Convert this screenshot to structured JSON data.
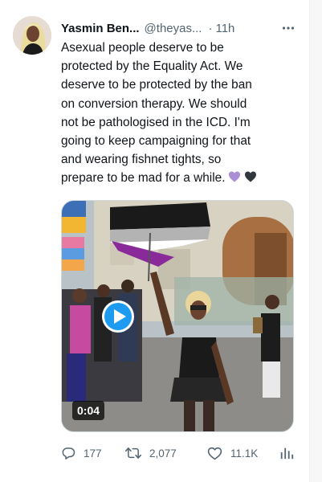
{
  "tweet": {
    "author": {
      "display_name": "Yasmin Ben...",
      "handle": "@theyas...",
      "separator": "·",
      "time": "11h"
    },
    "more_icon": "more-horizontal-icon",
    "text_lines": [
      "Asexual people deserve to be",
      "protected by the Equality Act. We",
      "deserve to be protected by the ban",
      "on conversion therapy. We should",
      "not be pathologised in the ICD. I'm",
      "going to keep campaigning for that",
      "and wearing fishnet tights, so",
      "prepare to be mad for a while."
    ],
    "emoji": [
      "purple-heart-icon",
      "black-heart-icon"
    ],
    "media": {
      "type": "video",
      "duration": "0:04",
      "play_icon": "play-icon"
    },
    "actions": {
      "replies": "177",
      "retweets": "2,077",
      "likes": "11.1K",
      "views_icon": "views-bar-chart-icon"
    },
    "colors": {
      "accent": "#1d9bf0",
      "secondary_text": "#536471",
      "primary_text": "#0f1419",
      "flag_asexual": [
        "#000000",
        "#a3a3a3",
        "#ffffff",
        "#800080"
      ],
      "heart_purple": "#aa8ed6",
      "heart_black": "#31373d"
    }
  }
}
